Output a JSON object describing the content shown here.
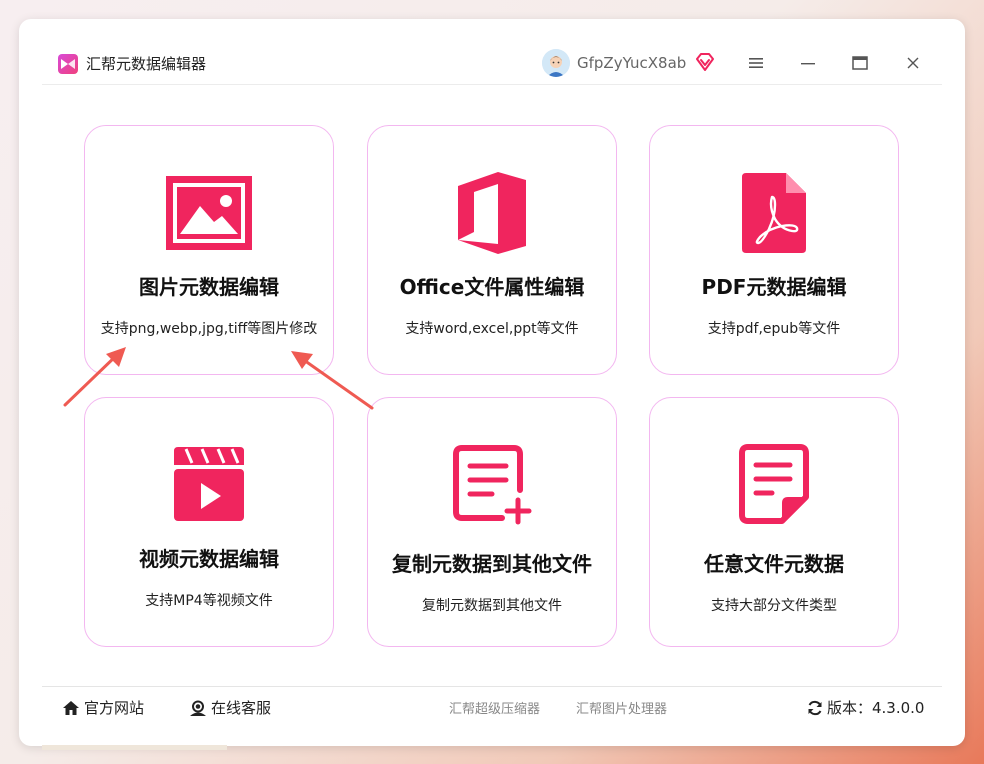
{
  "app": {
    "title": "汇帮元数据编辑器"
  },
  "user": {
    "name": "GfpZyYucX8ab"
  },
  "colors": {
    "accent": "#f0255e",
    "card_border": "#f3b7f0",
    "arrow": "#ef5a52"
  },
  "icons": {
    "menu": "hamburger-icon",
    "minimize": "minimize-icon",
    "maximize": "maximize-icon",
    "close": "close-icon"
  },
  "cards": [
    {
      "title": "图片元数据编辑",
      "desc": "支持png,webp,jpg,tiff等图片修改",
      "icon": "image-icon"
    },
    {
      "title": "Office文件属性编辑",
      "desc": "支持word,excel,ppt等文件",
      "icon": "office-icon"
    },
    {
      "title": "PDF元数据编辑",
      "desc": "支持pdf,epub等文件",
      "icon": "pdf-icon"
    },
    {
      "title": "视频元数据编辑",
      "desc": "支持MP4等视频文件",
      "icon": "video-icon"
    },
    {
      "title": "复制元数据到其他文件",
      "desc": "复制元数据到其他文件",
      "icon": "copy-document-icon"
    },
    {
      "title": "任意文件元数据",
      "desc": "支持大部分文件类型",
      "icon": "file-icon"
    }
  ],
  "footer": {
    "website": "官方网站",
    "support": "在线客服",
    "compressor": "汇帮超级压缩器",
    "image_processor": "汇帮图片处理器",
    "version": "版本：4.3.0.0"
  }
}
